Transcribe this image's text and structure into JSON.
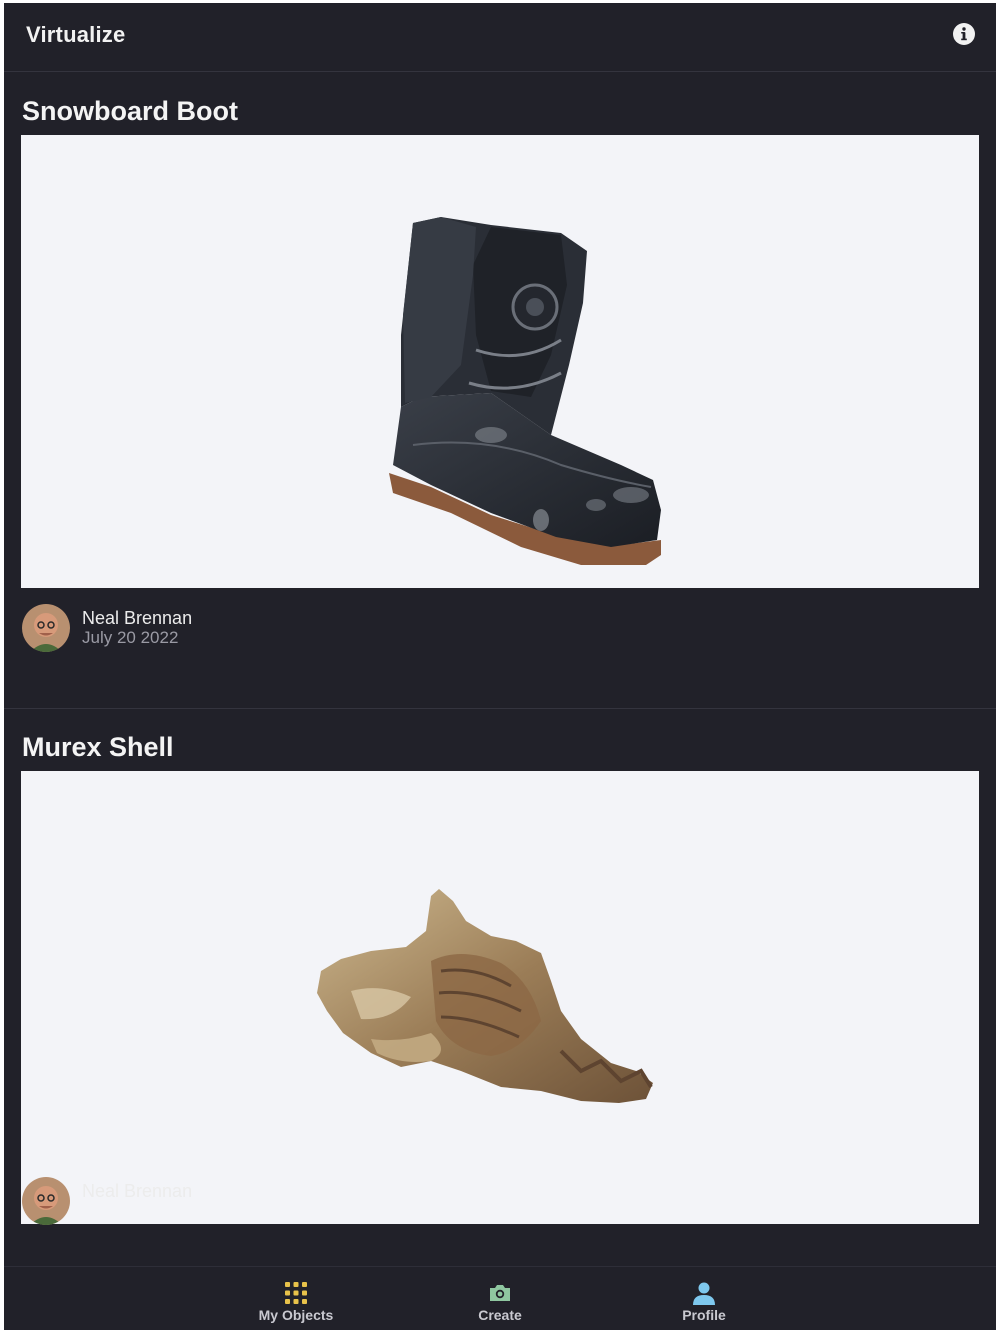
{
  "app": {
    "title": "Virtualize",
    "info_icon": "info-icon"
  },
  "posts": [
    {
      "title": "Snowboard Boot",
      "author_name": "Neal Brennan",
      "date": "July 20 2022",
      "model_icon": "snowboard-boot-model"
    },
    {
      "title": "Murex Shell",
      "author_name": "Neal Brennan",
      "date": "",
      "model_icon": "murex-shell-model"
    }
  ],
  "tabs": [
    {
      "label": "My Objects",
      "icon": "grid-icon",
      "color": "#e8c24a"
    },
    {
      "label": "Create",
      "icon": "camera-icon",
      "color": "#8fc7a0"
    },
    {
      "label": "Profile",
      "icon": "person-icon",
      "color": "#7ec8ee"
    }
  ],
  "colors": {
    "background": "#212129",
    "preview_background": "#f3f4f8",
    "text_primary": "#f4f4f4",
    "text_secondary": "#9a9aa4"
  }
}
